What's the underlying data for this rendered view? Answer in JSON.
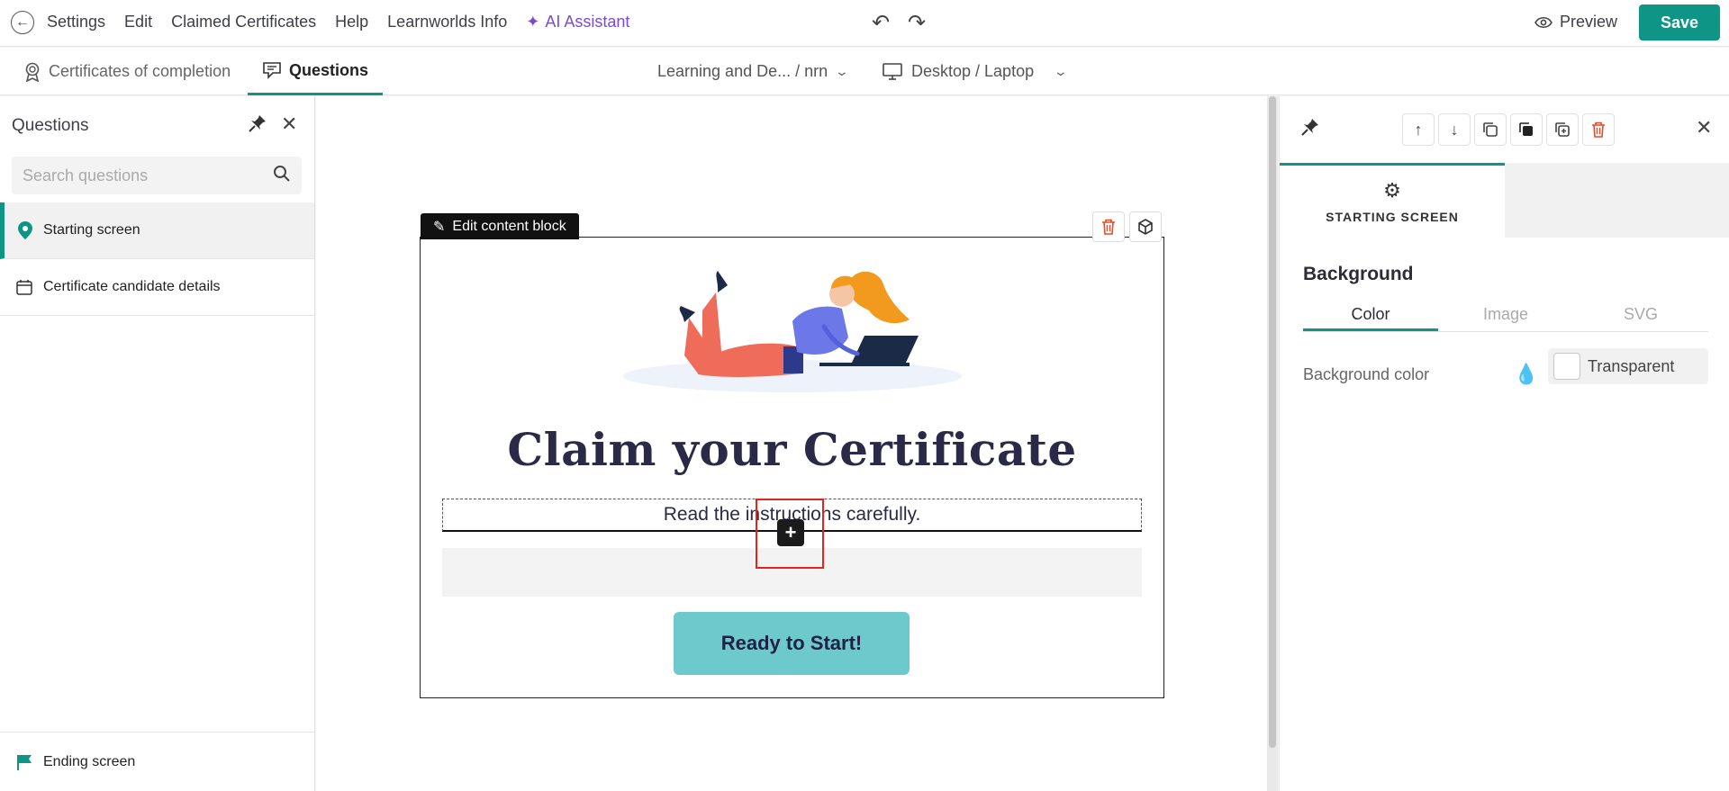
{
  "topbar": {
    "menu": [
      "Settings",
      "Edit",
      "Claimed Certificates",
      "Help",
      "Learnworlds Info"
    ],
    "ai_label": "AI Assistant",
    "preview_label": "Preview",
    "save_label": "Save"
  },
  "tabs": {
    "certificates": "Certificates of completion",
    "questions": "Questions"
  },
  "selectors": {
    "course": "Learning and De... / nrn",
    "device": "Desktop / Laptop"
  },
  "left_panel": {
    "title": "Questions",
    "search_placeholder": "Search questions",
    "items": [
      "Starting screen",
      "Certificate candidate details"
    ],
    "ending": "Ending screen"
  },
  "canvas": {
    "edit_label": "Edit content block",
    "headline": "Claim your Certificate",
    "subtext": "Read the instructions carefully.",
    "cta": "Ready to Start!"
  },
  "right_panel": {
    "tab_label": "STARTING SCREEN",
    "section": "Background",
    "subtabs": [
      "Color",
      "Image",
      "SVG"
    ],
    "bg_color_label": "Background color",
    "bg_color_value": "Transparent"
  },
  "colors": {
    "accent": "#0e9586",
    "ai": "#7b4bd6",
    "cta": "#6ec9cc",
    "delete": "#e04b2c"
  }
}
